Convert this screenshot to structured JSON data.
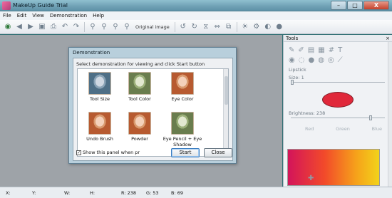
{
  "window": {
    "title": "MakeUp Guide Trial",
    "controls": {
      "minimize": "–",
      "maximize": "□",
      "close": "X"
    }
  },
  "menu": [
    "File",
    "Edit",
    "View",
    "Demonstration",
    "Help"
  ],
  "toolbar": {
    "original_image_label": "Original image"
  },
  "dialog": {
    "title": "Demonstration",
    "prompt": "Select demonstration for viewing and click Start button",
    "items": [
      {
        "label": "Tool Size",
        "photo": "blue"
      },
      {
        "label": "Tool Color",
        "photo": "green"
      },
      {
        "label": "Eye Color",
        "photo": "warm"
      },
      {
        "label": "Undo Brush",
        "photo": "warm"
      },
      {
        "label": "Powder",
        "photo": "warm"
      },
      {
        "label": "Eye Pencil + Eye Shadow",
        "photo": "green"
      }
    ],
    "show_panel_label": "Show this panel when pr",
    "show_panel_checked": true,
    "start_label": "Start",
    "close_label": "Close"
  },
  "tools": {
    "title": "Tools",
    "close": "×",
    "section": "Lipstick",
    "size_label": "Size: 1",
    "brightness_label": "Brightness: 238",
    "rgb_labels": [
      "Red",
      "Green",
      "Blue"
    ],
    "swatch_color": "#e0283a"
  },
  "status": {
    "x": "X:",
    "y": "Y:",
    "w": "W:",
    "h": "H:",
    "r": "R: 238",
    "g": "G: 53",
    "b": "B: 69"
  }
}
